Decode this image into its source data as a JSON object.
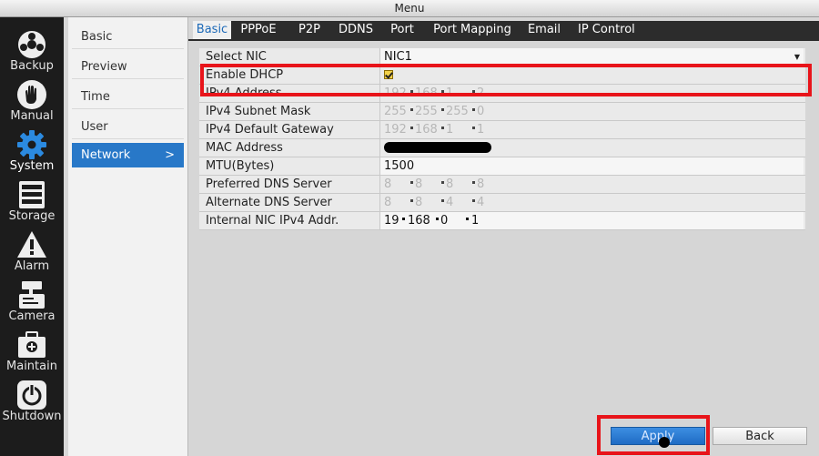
{
  "window": {
    "title": "Menu"
  },
  "nav": [
    {
      "label": "Backup",
      "icon": "backup-reel-icon"
    },
    {
      "label": "Manual",
      "icon": "hand-icon"
    },
    {
      "label": "System",
      "icon": "gear-icon",
      "active": true
    },
    {
      "label": "Storage",
      "icon": "storage-icon"
    },
    {
      "label": "Alarm",
      "icon": "alarm-warning-icon"
    },
    {
      "label": "Camera",
      "icon": "camera-icon"
    },
    {
      "label": "Maintain",
      "icon": "toolbox-icon"
    },
    {
      "label": "Shutdown",
      "icon": "power-icon"
    }
  ],
  "submenu": [
    {
      "label": "Basic"
    },
    {
      "label": "Preview"
    },
    {
      "label": "Time"
    },
    {
      "label": "User"
    },
    {
      "label": "Network",
      "active": true,
      "chevron": ">"
    }
  ],
  "tabs": [
    "Basic",
    "PPPoE",
    "P2P",
    "DDNS",
    "Port",
    "Port Mapping",
    "Email",
    "IP Control"
  ],
  "form": {
    "select_nic": {
      "label": "Select NIC",
      "value": "NIC1"
    },
    "enable_dhcp": {
      "label": "Enable DHCP",
      "checked": true
    },
    "ipv4_address": {
      "label": "IPv4 Address",
      "octets": [
        "192",
        "168",
        "1",
        "2"
      ]
    },
    "subnet_mask": {
      "label": "IPv4 Subnet Mask",
      "octets": [
        "255",
        "255",
        "255",
        "0"
      ]
    },
    "gateway": {
      "label": "IPv4 Default Gateway",
      "octets": [
        "192",
        "168",
        "1",
        "1"
      ]
    },
    "mac": {
      "label": "MAC Address"
    },
    "mtu": {
      "label": "MTU(Bytes)",
      "value": "1500"
    },
    "pref_dns": {
      "label": "Preferred DNS Server",
      "octets": [
        "8",
        "8",
        "8",
        "8"
      ]
    },
    "alt_dns": {
      "label": "Alternate DNS Server",
      "octets": [
        "8",
        "8",
        "4",
        "4"
      ]
    },
    "internal_nic": {
      "label": "Internal NIC IPv4 Addr.",
      "octets": [
        "19",
        "168",
        "0",
        "1"
      ]
    }
  },
  "buttons": {
    "apply": "Apply",
    "back": "Back"
  },
  "colors": {
    "accent": "#2878c8",
    "highlight": "#e8141a",
    "sidebar": "#1c1c1c"
  }
}
